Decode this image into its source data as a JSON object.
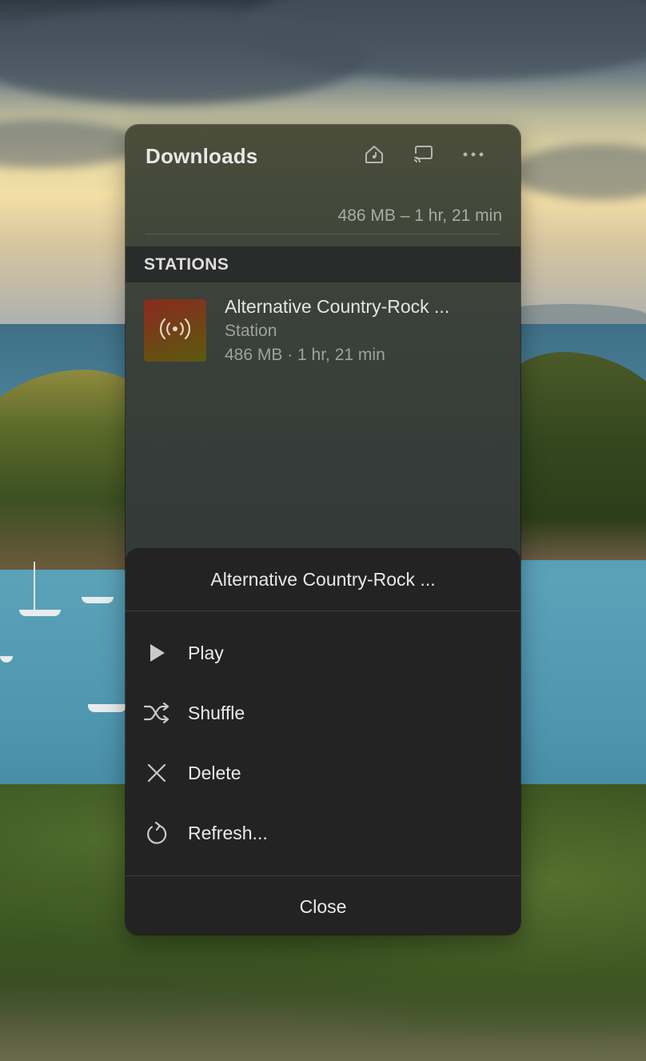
{
  "window": {
    "title": "Downloads",
    "summary": "486 MB – 1 hr, 21 min"
  },
  "toolbar": {
    "icons": [
      "home-icon",
      "cast-icon",
      "more-icon"
    ]
  },
  "section": {
    "header": "STATIONS"
  },
  "station": {
    "name": "Alternative Country-Rock ...",
    "type": "Station",
    "size": "486 MB · 1 hr, 21 min",
    "artwork_icon": "broadcast-icon"
  },
  "sheet": {
    "title": "Alternative Country-Rock ...",
    "actions": [
      {
        "label": "Play",
        "icon": "play-icon"
      },
      {
        "label": "Shuffle",
        "icon": "shuffle-icon"
      },
      {
        "label": "Delete",
        "icon": "delete-icon"
      },
      {
        "label": "Refresh...",
        "icon": "refresh-icon"
      }
    ],
    "close_label": "Close"
  },
  "colors": {
    "sheet_bg": "#232323",
    "section_header_bg": "#2a2c2c",
    "text_primary": "#e8e8e8",
    "text_secondary": "#9fa19c"
  }
}
